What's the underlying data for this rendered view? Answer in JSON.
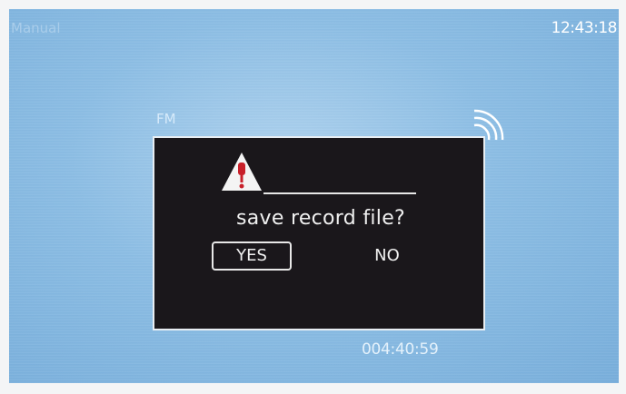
{
  "status_bar": {
    "mode": "Manual",
    "clock": "12:43:18"
  },
  "radio": {
    "band": "FM",
    "signal_icon": "signal-waves-icon"
  },
  "dialog": {
    "icon": "warning-triangle-icon",
    "question": "save record file?",
    "yes_label": "YES",
    "no_label": "NO",
    "selected": "YES"
  },
  "recording": {
    "elapsed": "004:40:59"
  },
  "colors": {
    "screen_bg": "#8bbde4",
    "dialog_bg": "#1a171b",
    "warning_red": "#c8202a"
  }
}
